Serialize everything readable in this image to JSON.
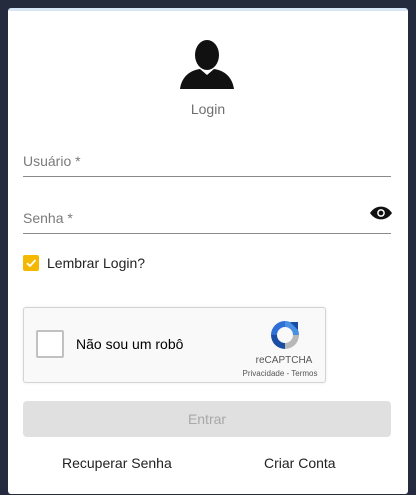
{
  "login": {
    "title": "Login",
    "username_label": "Usuário *",
    "password_label": "Senha *",
    "remember_label": "Lembrar Login?",
    "remember_checked": true,
    "enter_label": "Entrar",
    "recover_label": "Recuperar Senha",
    "create_label": "Criar Conta"
  },
  "recaptcha": {
    "label": "Não sou um robô",
    "brand": "reCAPTCHA",
    "terms": "Privacidade - Termos"
  },
  "colors": {
    "background": "#252b3f",
    "checkbox": "#f5b800",
    "card": "#ffffff"
  },
  "icons": {
    "user": "user-icon",
    "eye": "eye-icon",
    "check": "check-icon",
    "recaptcha": "recaptcha-logo-icon"
  }
}
